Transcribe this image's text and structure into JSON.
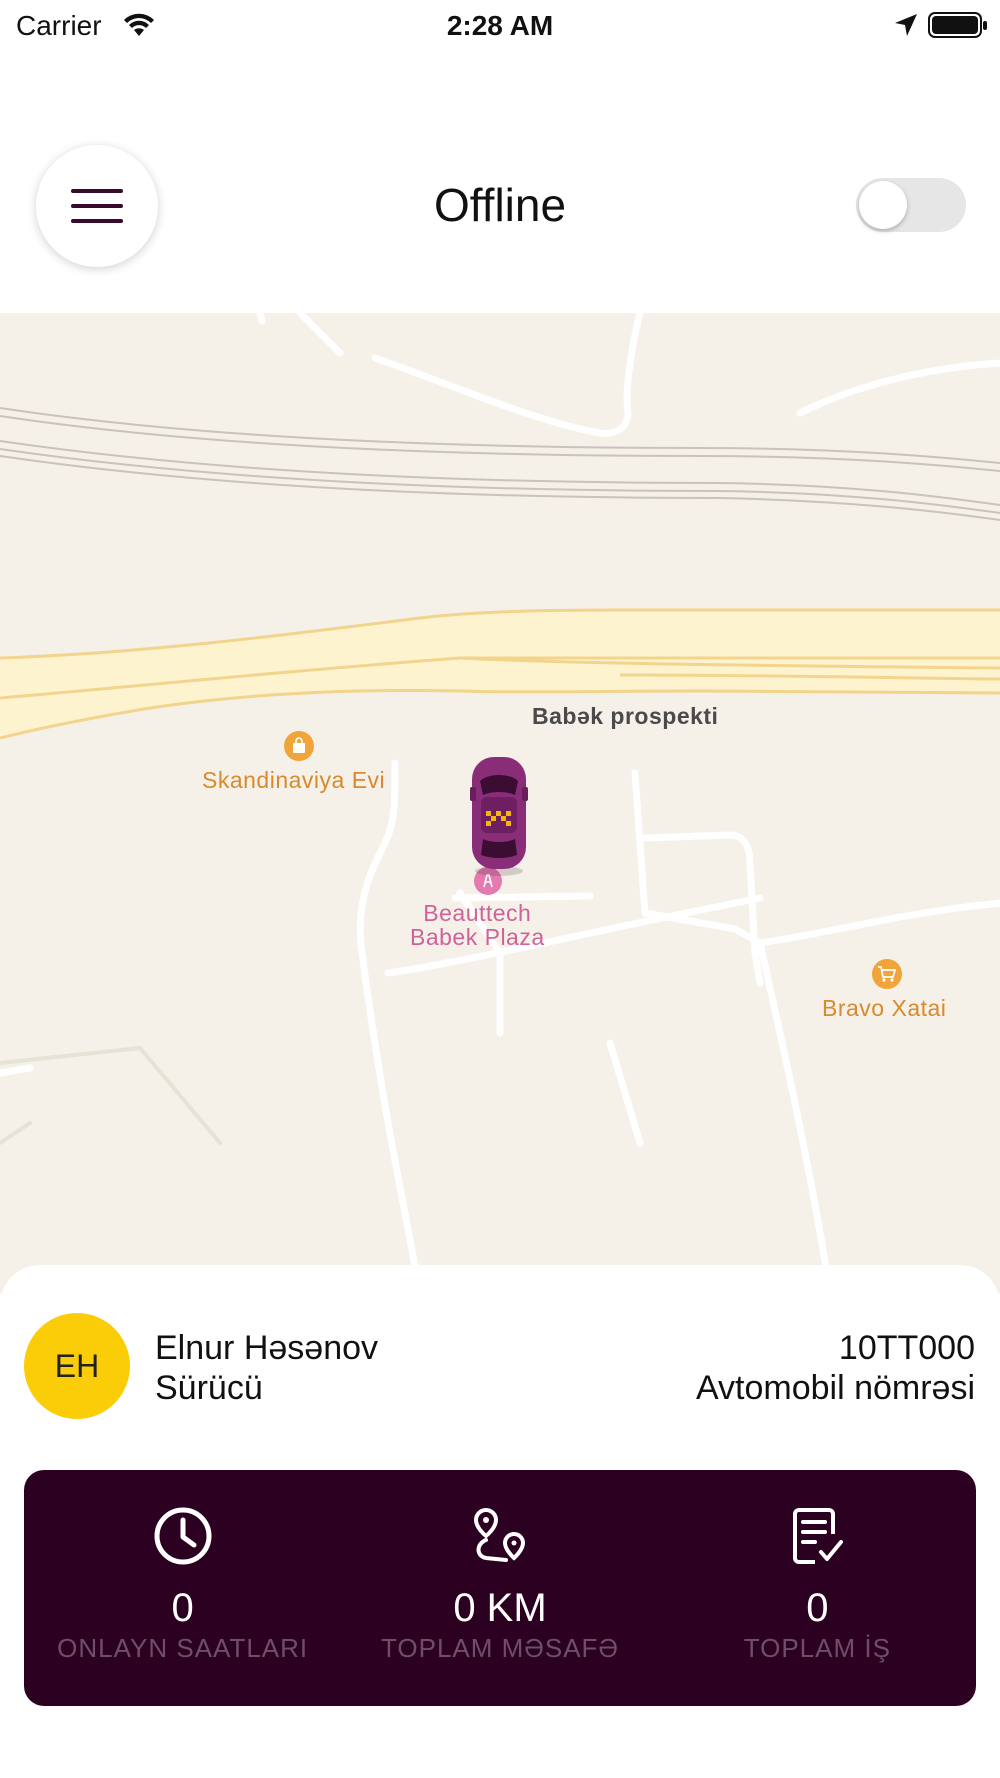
{
  "status_bar": {
    "carrier": "Carrier",
    "time": "2:28 AM"
  },
  "header": {
    "title": "Offline",
    "toggle_on": false
  },
  "map": {
    "street": "Babək prospekti",
    "pois": {
      "skandinaviya": "Skandinaviya Evi",
      "bravo": "Bravo Xatai",
      "beauttech_line1": "Beauttech",
      "beauttech_line2": "Babek Plaza"
    }
  },
  "driver": {
    "initials": "EH",
    "name": "Elnur Həsənov",
    "role": "Sürücü",
    "plate": "10TT000",
    "plate_label": "Avtomobil nömrəsi"
  },
  "stats": [
    {
      "icon": "clock-icon",
      "value": "0",
      "label": "ONLAYN SAATLARI"
    },
    {
      "icon": "route-icon",
      "value": "0 KM",
      "label": "TOPLAM MƏSAFƏ"
    },
    {
      "icon": "task-list-icon",
      "value": "0",
      "label": "TOPLAM İŞ"
    }
  ],
  "colors": {
    "brand": "#2c0020",
    "avatar": "#fbcc08",
    "map_bg": "#f5f0e8"
  }
}
